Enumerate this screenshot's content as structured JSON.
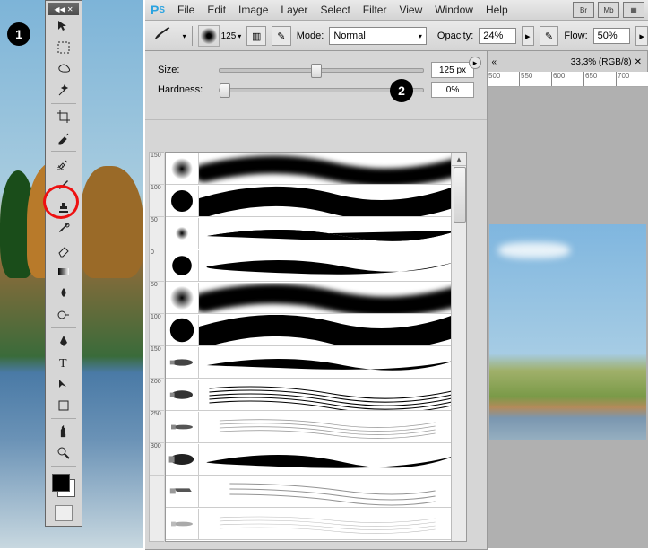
{
  "toolbar": {
    "head_text": "◀◀ ✕"
  },
  "badges": {
    "b1": "1",
    "b2": "2"
  },
  "menu": {
    "ps_p": "P",
    "ps_s": "S",
    "file": "File",
    "edit": "Edit",
    "image": "Image",
    "layer": "Layer",
    "select": "Select",
    "filter": "Filter",
    "view": "View",
    "window": "Window",
    "help": "Help",
    "btn_br": "Br",
    "btn_mb": "Mb",
    "btn_grid": "▦"
  },
  "options": {
    "brush_preview_size": "125",
    "caret": "▾",
    "toggle_panel": "▥",
    "airbrush": "✎",
    "mode_label": "Mode:",
    "mode_value": "Normal",
    "opacity_label": "Opacity:",
    "opacity_value": "24%",
    "opacity_btn": "▸",
    "pressure_btn": "✎",
    "flow_label": "Flow:",
    "flow_value": "50%",
    "flow_btn": "▸"
  },
  "tab": {
    "zoom": "33,3% (RGB/8)",
    "close": "✕",
    "chev": "«",
    "nav": "▤"
  },
  "ruler_ticks": [
    "500",
    "550",
    "600",
    "650",
    "700"
  ],
  "panel": {
    "size_label": "Size:",
    "size_value": "125 px",
    "hardness_label": "Hardness:",
    "hardness_value": "0%",
    "flyout": "▸",
    "rulerticks": [
      "150",
      "100",
      "50",
      "0",
      "50",
      "100",
      "150",
      "200",
      "250",
      "300"
    ]
  }
}
